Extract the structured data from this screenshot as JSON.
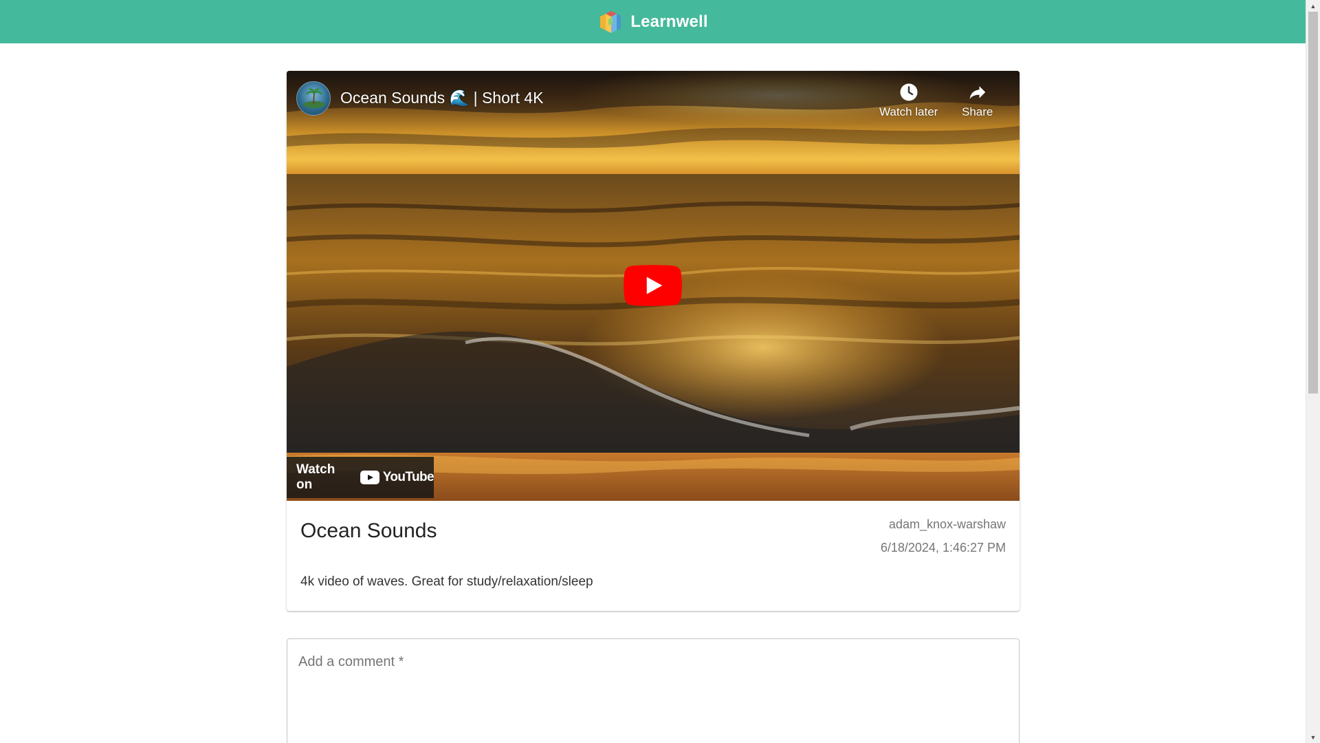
{
  "header": {
    "brand_name": "Learnwell",
    "background_color": "#45b99b"
  },
  "video": {
    "title": "Ocean Sounds 🌊 | Short 4K",
    "watch_later_label": "Watch later",
    "share_label": "Share",
    "watch_on_label": "Watch on",
    "youtube_label": "YouTube",
    "play_button_color": "#ff0000"
  },
  "post": {
    "title": "Ocean Sounds",
    "author": "adam_knox-warshaw",
    "timestamp": "6/18/2024, 1:46:27 PM",
    "description": "4k video of waves. Great for study/relaxation/sleep"
  },
  "comment": {
    "placeholder": "Add a comment *"
  },
  "icons": {
    "brand": "learnwell-logo-icon",
    "watch_later": "clock-icon",
    "share": "share-arrow-icon",
    "play": "play-icon",
    "youtube": "youtube-logo-icon"
  }
}
